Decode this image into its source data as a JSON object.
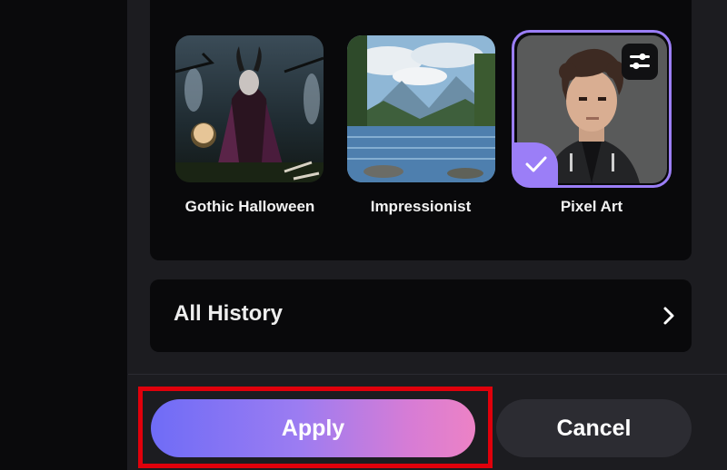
{
  "styles": [
    {
      "label": "Gothic Halloween",
      "selected": false
    },
    {
      "label": "Impressionist",
      "selected": false
    },
    {
      "label": "Pixel Art",
      "selected": true
    }
  ],
  "history": {
    "label": "All History"
  },
  "actions": {
    "apply_label": "Apply",
    "cancel_label": "Cancel"
  },
  "colors": {
    "accent": "#9b7ef7",
    "highlight": "#e0000b",
    "panel": "#09090b",
    "background": "#1c1c20"
  },
  "icons": {
    "selected": "check-icon",
    "settings": "sliders-icon",
    "history": "chevron-right-icon"
  }
}
